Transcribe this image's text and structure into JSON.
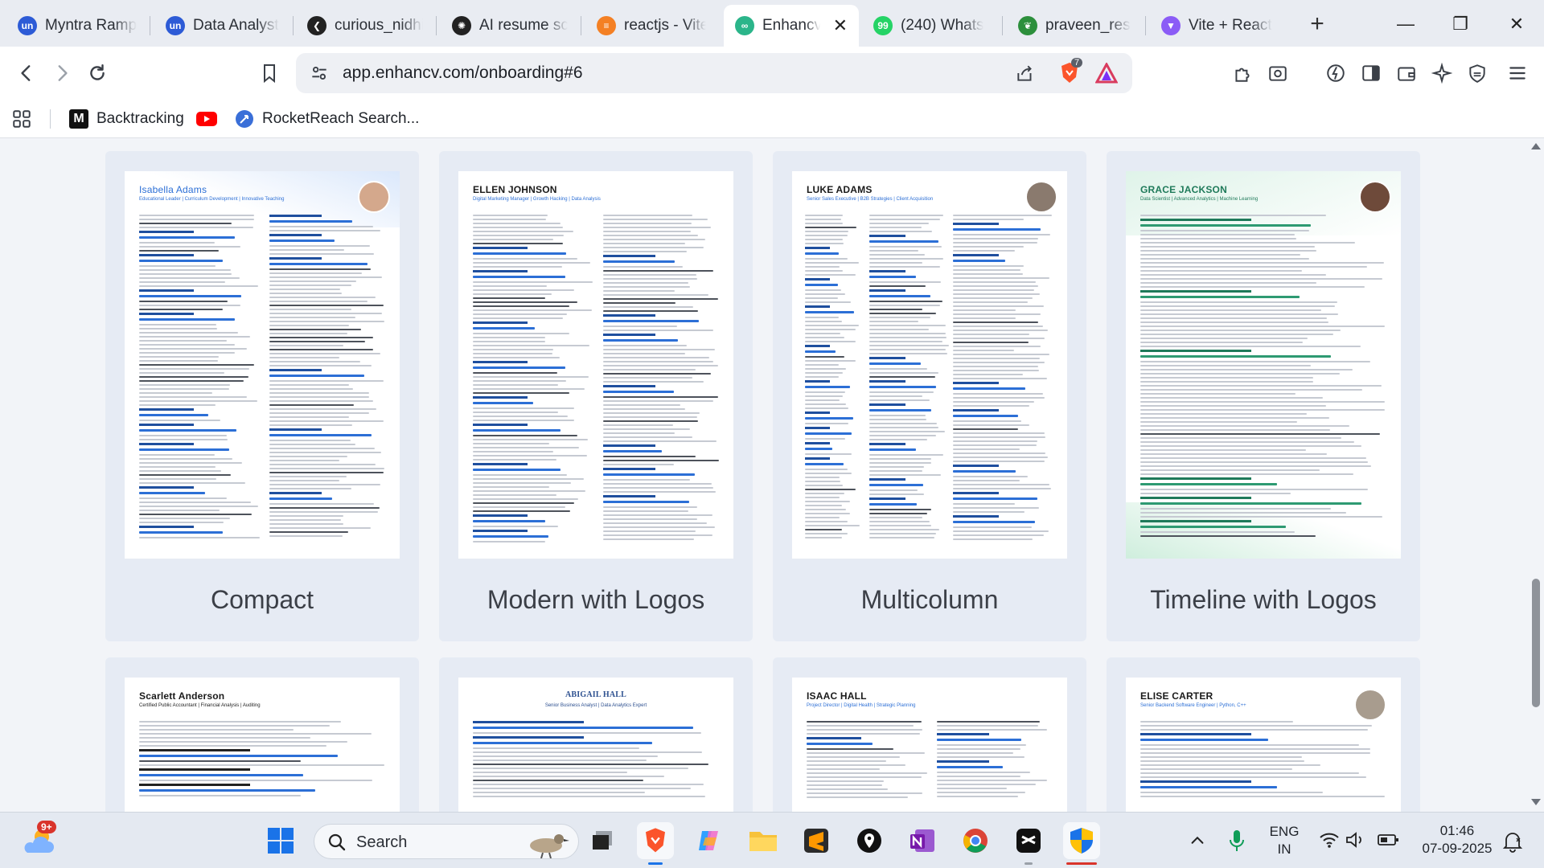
{
  "browser": {
    "tabs": [
      {
        "title": "Myntra Ramp",
        "icon": "unstop-icon",
        "color": "#2d5bd6",
        "glyph": "un"
      },
      {
        "title": "Data Analyst",
        "icon": "unstop-icon",
        "color": "#2d5bd6",
        "glyph": "un"
      },
      {
        "title": "curious_nidhi",
        "icon": "chevron-left-logo-icon",
        "color": "#222222",
        "glyph": "❮"
      },
      {
        "title": "AI resume sc",
        "icon": "openai-icon",
        "color": "#222222",
        "glyph": "✺"
      },
      {
        "title": "reactjs - Vite",
        "icon": "stackoverflow-icon",
        "color": "#f48024",
        "glyph": "≡"
      },
      {
        "title": "Enhancv",
        "icon": "enhancv-icon",
        "color": "#2bb58a",
        "glyph": "∞"
      },
      {
        "title": "(240) Whats",
        "icon": "whatsapp-icon",
        "color": "#25d366",
        "glyph": "99"
      },
      {
        "title": "praveen_res",
        "icon": "leaf-icon",
        "color": "#2c8f3c",
        "glyph": "❦"
      },
      {
        "title": "Vite + React",
        "icon": "vite-icon",
        "color": "#8b5cf6",
        "glyph": "▼"
      }
    ],
    "active_tab": 5,
    "url": "app.enhancv.com/onboarding#6",
    "brave_badge": "7",
    "bookmarks": [
      {
        "label": "Backtracking",
        "icon": "medium-icon"
      },
      {
        "label": "",
        "icon": "youtube-icon"
      },
      {
        "label": "RocketReach Search...",
        "icon": "rocketreach-icon"
      }
    ]
  },
  "templates": [
    {
      "label": "Compact",
      "name": "Isabella Adams",
      "subtitle": "Educational Leader | Curriculum Development | Innovative Teaching",
      "accent": "#2c6fd6",
      "style": "compact"
    },
    {
      "label": "Modern with Logos",
      "name": "ELLEN JOHNSON",
      "subtitle": "Digital Marketing Manager | Growth Hacking | Data Analysis",
      "accent": "#2c6fd6",
      "style": "modern"
    },
    {
      "label": "Multicolumn",
      "name": "LUKE ADAMS",
      "subtitle": "Senior Sales Executive | B2B Strategies | Client Acquisition",
      "accent": "#2c6fd6",
      "style": "multi"
    },
    {
      "label": "Timeline with Logos",
      "name": "GRACE JACKSON",
      "subtitle": "Data Scientist | Advanced Analytics | Machine Learning",
      "accent": "#1f7a5a",
      "style": "timeline"
    },
    {
      "label": "",
      "name": "Scarlett Anderson",
      "subtitle": "Certified Public Accountant | Financial Analysis | Auditing",
      "accent": "#222222",
      "style": "plain"
    },
    {
      "label": "",
      "name": "ABIGAIL HALL",
      "subtitle": "Senior Business Analyst | Data Analytics Expert",
      "accent": "#2c4f8f",
      "style": "serif"
    },
    {
      "label": "",
      "name": "ISAAC HALL",
      "subtitle": "Project Director | Digital Health | Strategic Planning",
      "accent": "#2c6fd6",
      "style": "light"
    },
    {
      "label": "",
      "name": "ELISE CARTER",
      "subtitle": "Senior Backend Software Engineer | Python, C++",
      "accent": "#2c6fd6",
      "style": "photo"
    }
  ],
  "taskbar": {
    "search_placeholder": "Search",
    "weather_badge": "9+",
    "language": "ENG",
    "region": "IN",
    "time": "01:46",
    "date": "07-09-2025"
  }
}
